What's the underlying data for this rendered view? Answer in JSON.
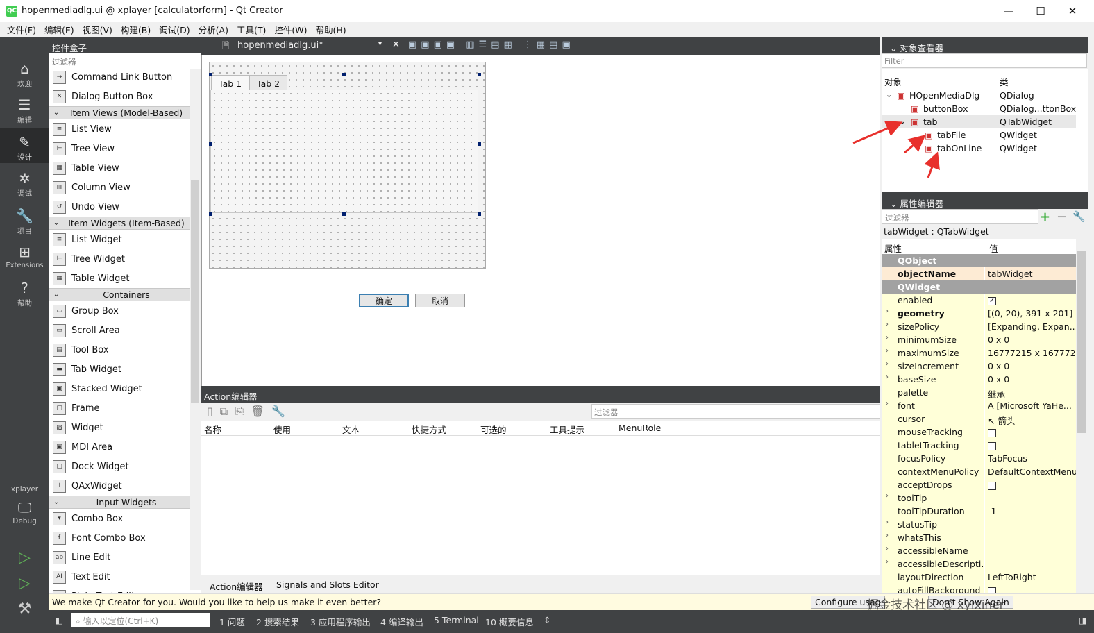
{
  "window": {
    "title": "hopenmediadlg.ui @ xplayer [calculatorform] - Qt Creator",
    "app_icon": "QC",
    "minimize": "—",
    "maximize": "☐",
    "close": "✕"
  },
  "menubar": [
    "文件(F)",
    "编辑(E)",
    "视图(V)",
    "构建(B)",
    "调试(D)",
    "分析(A)",
    "工具(T)",
    "控件(W)",
    "帮助(H)"
  ],
  "modes": [
    {
      "label": "欢迎",
      "icon": "⌂"
    },
    {
      "label": "编辑",
      "icon": "☰"
    },
    {
      "label": "设计",
      "icon": "✎"
    },
    {
      "label": "调试",
      "icon": "✲"
    },
    {
      "label": "项目",
      "icon": "🔧"
    },
    {
      "label": "Extensions",
      "icon": "⊞"
    },
    {
      "label": "帮助",
      "icon": "?"
    }
  ],
  "kit": {
    "project": "xplayer",
    "config": "Debug"
  },
  "toolbox": {
    "title": "控件盒子",
    "filter_placeholder": "过滤器",
    "rows": [
      {
        "kind": "item",
        "label": "Command Link Button",
        "icon": "→"
      },
      {
        "kind": "item",
        "label": "Dialog Button Box",
        "icon": "✕"
      },
      {
        "kind": "cat",
        "label": "Item Views (Model-Based)"
      },
      {
        "kind": "item",
        "label": "List View",
        "icon": "≡"
      },
      {
        "kind": "item",
        "label": "Tree View",
        "icon": "⊢"
      },
      {
        "kind": "item",
        "label": "Table View",
        "icon": "▦"
      },
      {
        "kind": "item",
        "label": "Column View",
        "icon": "▥"
      },
      {
        "kind": "item",
        "label": "Undo View",
        "icon": "↺"
      },
      {
        "kind": "cat",
        "label": "Item Widgets (Item-Based)"
      },
      {
        "kind": "item",
        "label": "List Widget",
        "icon": "≡"
      },
      {
        "kind": "item",
        "label": "Tree Widget",
        "icon": "⊢"
      },
      {
        "kind": "item",
        "label": "Table Widget",
        "icon": "▦"
      },
      {
        "kind": "cat",
        "label": "Containers"
      },
      {
        "kind": "item",
        "label": "Group Box",
        "icon": "▭"
      },
      {
        "kind": "item",
        "label": "Scroll Area",
        "icon": "▭"
      },
      {
        "kind": "item",
        "label": "Tool Box",
        "icon": "▤"
      },
      {
        "kind": "item",
        "label": "Tab Widget",
        "icon": "▬"
      },
      {
        "kind": "item",
        "label": "Stacked Widget",
        "icon": "▣"
      },
      {
        "kind": "item",
        "label": "Frame",
        "icon": "▢"
      },
      {
        "kind": "item",
        "label": "Widget",
        "icon": "▨"
      },
      {
        "kind": "item",
        "label": "MDI Area",
        "icon": "▣"
      },
      {
        "kind": "item",
        "label": "Dock Widget",
        "icon": "▢"
      },
      {
        "kind": "item",
        "label": "QAxWidget",
        "icon": "⊥"
      },
      {
        "kind": "cat",
        "label": "Input Widgets"
      },
      {
        "kind": "item",
        "label": "Combo Box",
        "icon": "▾"
      },
      {
        "kind": "item",
        "label": "Font Combo Box",
        "icon": "f"
      },
      {
        "kind": "item",
        "label": "Line Edit",
        "icon": "ab"
      },
      {
        "kind": "item",
        "label": "Text Edit",
        "icon": "AI"
      }
    ],
    "partial_last": "Plain Text Edit"
  },
  "editor": {
    "document": "hopenmediadlg.ui*"
  },
  "form": {
    "tabs": [
      "Tab 1",
      "Tab 2"
    ],
    "ok": "确定",
    "cancel": "取消"
  },
  "action_editor": {
    "title": "Action编辑器",
    "filter_placeholder": "过滤器",
    "columns": [
      "名称",
      "使用",
      "文本",
      "快捷方式",
      "可选的",
      "工具提示",
      "MenuRole"
    ],
    "bottom_tabs": [
      "Action编辑器",
      "Signals and Slots Editor"
    ]
  },
  "object_inspector": {
    "title": "对象查看器",
    "filter_placeholder": "Filter",
    "col_object": "对象",
    "col_class": "类",
    "rows": [
      {
        "name": "HOpenMediaDlg",
        "cls": "QDialog",
        "indent": 0,
        "expand": "⌄"
      },
      {
        "name": "buttonBox",
        "cls": "QDialog...ttonBox",
        "indent": 1,
        "expand": ""
      },
      {
        "name": "tab",
        "cls": "QTabWidget",
        "indent": 1,
        "expand": "⌄",
        "selected": true
      },
      {
        "name": "tabFile",
        "cls": "QWidget",
        "indent": 2,
        "expand": ""
      },
      {
        "name": "tabOnLine",
        "cls": "QWidget",
        "indent": 2,
        "expand": ""
      }
    ]
  },
  "property_editor": {
    "title": "属性编辑器",
    "filter_placeholder": "过滤器",
    "subtitle": "tabWidget : QTabWidget",
    "col_prop": "属性",
    "col_value": "值",
    "rows": [
      {
        "name": "QObject",
        "group": true
      },
      {
        "name": "objectName",
        "value": "tabWidget",
        "bold": true,
        "hl": true
      },
      {
        "name": "QWidget",
        "group": true
      },
      {
        "name": "enabled",
        "check": true,
        "checked": true
      },
      {
        "name": "geometry",
        "value": "[(0, 20), 391 x 201]",
        "bold": true,
        "exp": true
      },
      {
        "name": "sizePolicy",
        "value": "[Expanding, Expan...",
        "exp": true
      },
      {
        "name": "minimumSize",
        "value": "0 x 0",
        "exp": true
      },
      {
        "name": "maximumSize",
        "value": "16777215 x 167772...",
        "exp": true
      },
      {
        "name": "sizeIncrement",
        "value": "0 x 0",
        "exp": true
      },
      {
        "name": "baseSize",
        "value": "0 x 0",
        "exp": true
      },
      {
        "name": "palette",
        "value": "继承"
      },
      {
        "name": "font",
        "value": "A  [Microsoft YaHe...",
        "exp": true
      },
      {
        "name": "cursor",
        "value": "↖  箭头"
      },
      {
        "name": "mouseTracking",
        "check": true,
        "checked": false
      },
      {
        "name": "tabletTracking",
        "check": true,
        "checked": false
      },
      {
        "name": "focusPolicy",
        "value": "TabFocus"
      },
      {
        "name": "contextMenuPolicy",
        "value": "DefaultContextMenu"
      },
      {
        "name": "acceptDrops",
        "check": true,
        "checked": false
      },
      {
        "name": "toolTip",
        "value": "",
        "exp": true
      },
      {
        "name": "toolTipDuration",
        "value": "-1"
      },
      {
        "name": "statusTip",
        "value": "",
        "exp": true
      },
      {
        "name": "whatsThis",
        "value": "",
        "exp": true
      },
      {
        "name": "accessibleName",
        "value": "",
        "exp": true
      },
      {
        "name": "accessibleDescripti...",
        "value": "",
        "exp": true
      },
      {
        "name": "layoutDirection",
        "value": "LeftToRight"
      },
      {
        "name": "autoFillBackground",
        "check": true,
        "checked": false
      }
    ]
  },
  "notification": {
    "text": "We make Qt Creator for you. Would you like to help us make it even better?",
    "configure": "Configure usag",
    "dont_show": "Don't Show Again",
    "watermark": "掘金技术社区 @ xylxiner"
  },
  "statusbar": {
    "locator_placeholder": "输入以定位(Ctrl+K)",
    "panes": [
      "1 问题",
      "2 搜索结果",
      "3 应用程序输出",
      "4 编译输出",
      "5 Terminal",
      "10 概要信息"
    ]
  },
  "colors": {
    "dark": "#404244",
    "accent_arrow": "#e8302c",
    "prop_bg": "#ffffd8",
    "group": "#a2a2a2"
  }
}
